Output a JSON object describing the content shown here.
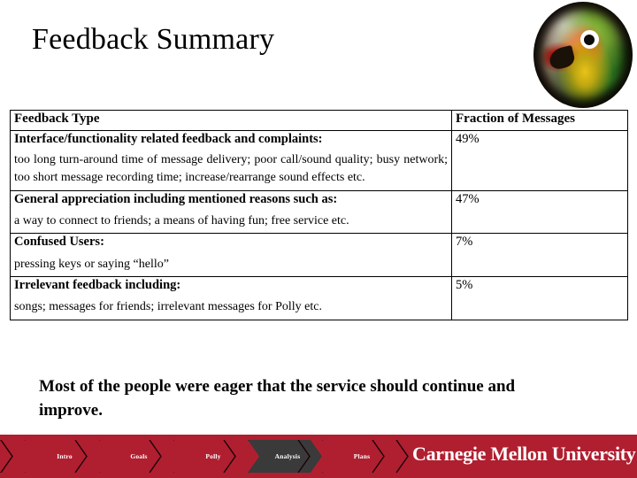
{
  "slide": {
    "title": "Feedback Summary",
    "closing_statement": "Most of the people were eager that the service should continue and improve."
  },
  "media": {
    "parrot_photo_alt": "lovebird-parrot-photo"
  },
  "table": {
    "headers": {
      "type": "Feedback Type",
      "fraction": "Fraction of Messages"
    },
    "rows": [
      {
        "category": "Interface/functionality related feedback and complaints:",
        "detail": "too long turn-around time of message delivery; poor call/sound quality; busy network; too short message recording time; increase/rearrange sound effects etc.",
        "fraction": "49%"
      },
      {
        "category": "General appreciation including mentioned reasons such as:",
        "detail": "a way to connect to friends; a means of having fun; free service etc.",
        "fraction": "47%"
      },
      {
        "category": "Confused Users:",
        "detail": "pressing keys or saying “hello”",
        "fraction": "7%"
      },
      {
        "category": "Irrelevant feedback including:",
        "detail": "songs; messages for friends; irrelevant messages for Polly etc.",
        "fraction": "5%"
      }
    ]
  },
  "footer": {
    "nav_items": [
      {
        "label": "Intro",
        "active": false
      },
      {
        "label": "Goals",
        "active": false
      },
      {
        "label": "Polly",
        "active": false
      },
      {
        "label": "Analysis",
        "active": true
      },
      {
        "label": "Plans",
        "active": false
      }
    ],
    "wordmark": "Carnegie Mellon University",
    "colors": {
      "bar_red": "#b01f30",
      "active_chevron": "#3a3a3a",
      "text": "#ffffff"
    }
  },
  "chart_data": {
    "type": "table",
    "title": "Feedback Summary",
    "categories": [
      "Interface/functionality related feedback and complaints",
      "General appreciation including mentioned reasons such as",
      "Confused Users",
      "Irrelevant feedback including"
    ],
    "values": [
      49,
      47,
      7,
      5
    ],
    "value_labels": [
      "49%",
      "47%",
      "7%",
      "5%"
    ],
    "xlabel": "Feedback Type",
    "ylabel": "Fraction of Messages",
    "ylim": [
      0,
      100
    ],
    "units": "percent of messages"
  }
}
